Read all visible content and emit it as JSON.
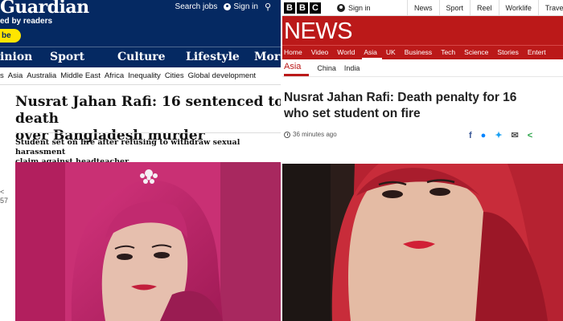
{
  "guardian": {
    "logo": "Guardian",
    "supported": "ed by readers",
    "cta": "be",
    "links": {
      "search": "Search jobs",
      "signin": "Sign in"
    },
    "pillars": [
      "inion",
      "Sport",
      "Culture",
      "Lifestyle",
      "More"
    ],
    "subnav": [
      "s",
      "Asia",
      "Australia",
      "Middle East",
      "Africa",
      "Inequality",
      "Cities",
      "Global development"
    ],
    "headline_line1": "Nusrat Jahan Rafi: 16 sentenced to death",
    "headline_line2": "over Bangladesh murder",
    "standfirst_line1": "Student set on fire after refusing to withdraw sexual harassment",
    "standfirst_line2": "claim against headteacher",
    "share_count": "57",
    "share_icon": "share-icon"
  },
  "bbc": {
    "logo_letters": [
      "B",
      "B",
      "C"
    ],
    "signin": "Sign in",
    "topnav": [
      "News",
      "Sport",
      "Reel",
      "Worklife",
      "Travel"
    ],
    "masthead": "NEWS",
    "nav": [
      "Home",
      "Video",
      "World",
      "Asia",
      "UK",
      "Business",
      "Tech",
      "Science",
      "Stories",
      "Entert"
    ],
    "active_nav": "Asia",
    "subnav": {
      "current": "Asia",
      "items": [
        "China",
        "India"
      ]
    },
    "headline_line1": "Nusrat Jahan Rafi: Death penalty for 16",
    "headline_line2": "who set student on fire",
    "timestamp": "36 minutes ago",
    "share_icons": [
      "facebook-icon",
      "messenger-icon",
      "twitter-icon",
      "email-icon",
      "share-icon"
    ]
  },
  "colors": {
    "guardian_navy": "#052962",
    "guardian_yellow": "#ffe500",
    "bbc_red": "#bb1919"
  }
}
